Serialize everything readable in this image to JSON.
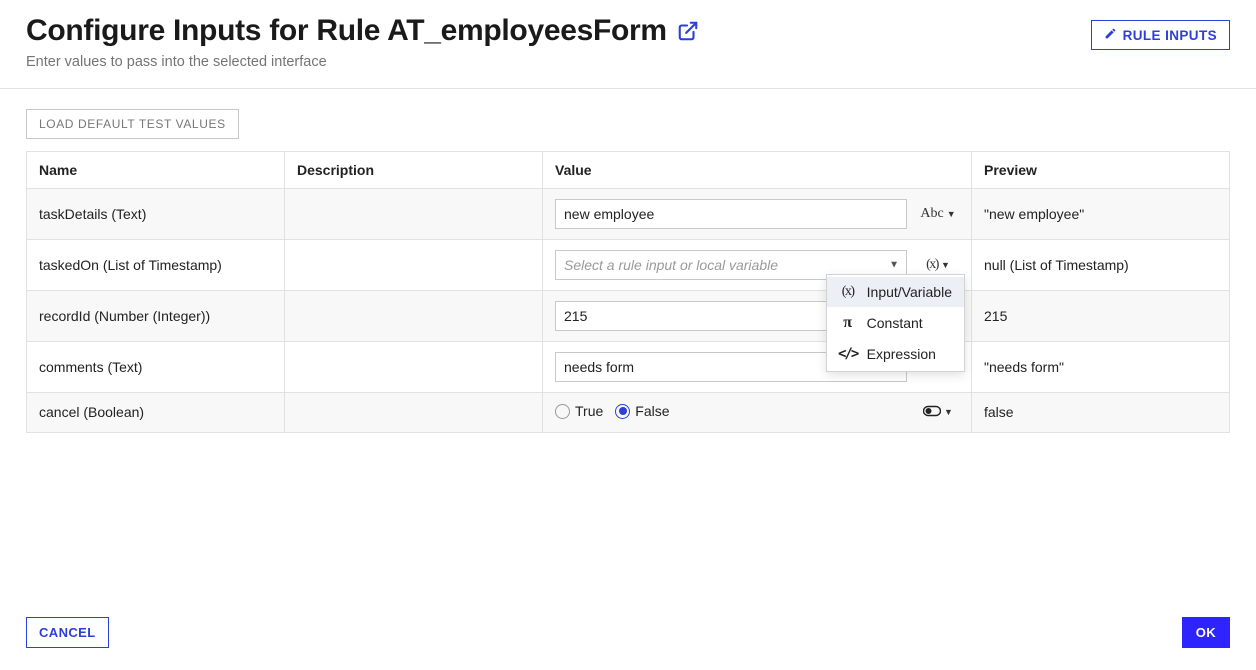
{
  "header": {
    "title": "Configure Inputs for Rule AT_employeesForm",
    "subtitle": "Enter values to pass into the selected interface",
    "rule_inputs_label": "RULE INPUTS"
  },
  "buttons": {
    "load_defaults": "LOAD DEFAULT TEST VALUES",
    "cancel": "CANCEL",
    "ok": "OK"
  },
  "table": {
    "columns": {
      "name": "Name",
      "description": "Description",
      "value": "Value",
      "preview": "Preview"
    }
  },
  "rows": [
    {
      "name": "taskDetails (Text)",
      "value": "new employee",
      "type_indicator": "Abc",
      "preview": "\"new employee\""
    },
    {
      "name": "taskedOn (List of Timestamp)",
      "value": "",
      "placeholder": "Select a rule input or local variable",
      "type_indicator": "(x)",
      "preview": "null (List of Timestamp)"
    },
    {
      "name": "recordId (Number (Integer))",
      "value": "215",
      "type_indicator": "",
      "preview": "215"
    },
    {
      "name": "comments (Text)",
      "value": "needs form",
      "type_indicator": "",
      "preview": "\"needs form\""
    },
    {
      "name": "cancel (Boolean)",
      "value_true": "True",
      "value_false": "False",
      "type_indicator": "toggle",
      "preview": "false"
    }
  ],
  "dropdown": {
    "item_var": "Input/Variable",
    "item_const": "Constant",
    "item_expr": "Expression"
  }
}
